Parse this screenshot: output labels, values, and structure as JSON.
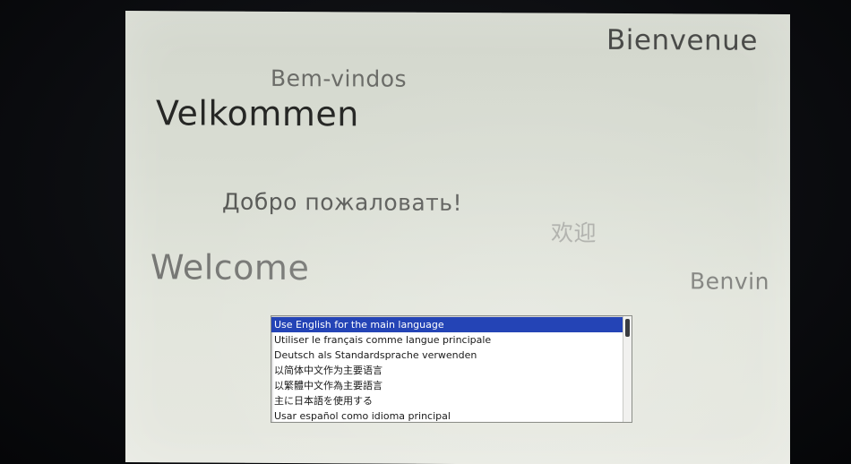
{
  "greetings": {
    "bienvenue": "Bienvenue",
    "bem_vindos": "Bem-vindos",
    "velkommen": "Velkommen",
    "dobro": "Добро пожаловать!",
    "huanying": "欢迎",
    "welcome": "Welcome",
    "benvin": "Benvin"
  },
  "language_list": {
    "selected_index": 0,
    "items": [
      "Use English for the main language",
      "Utiliser le français comme langue principale",
      "Deutsch als Standardsprache verwenden",
      "以简体中文作为主要语言",
      "以繁體中文作為主要語言",
      "主に日本語を使用する",
      "Usar español como idioma principal"
    ]
  },
  "colors": {
    "selection": "#2444b6",
    "screen_background": "#dcdfd6",
    "bezel": "#0b0c0f"
  }
}
